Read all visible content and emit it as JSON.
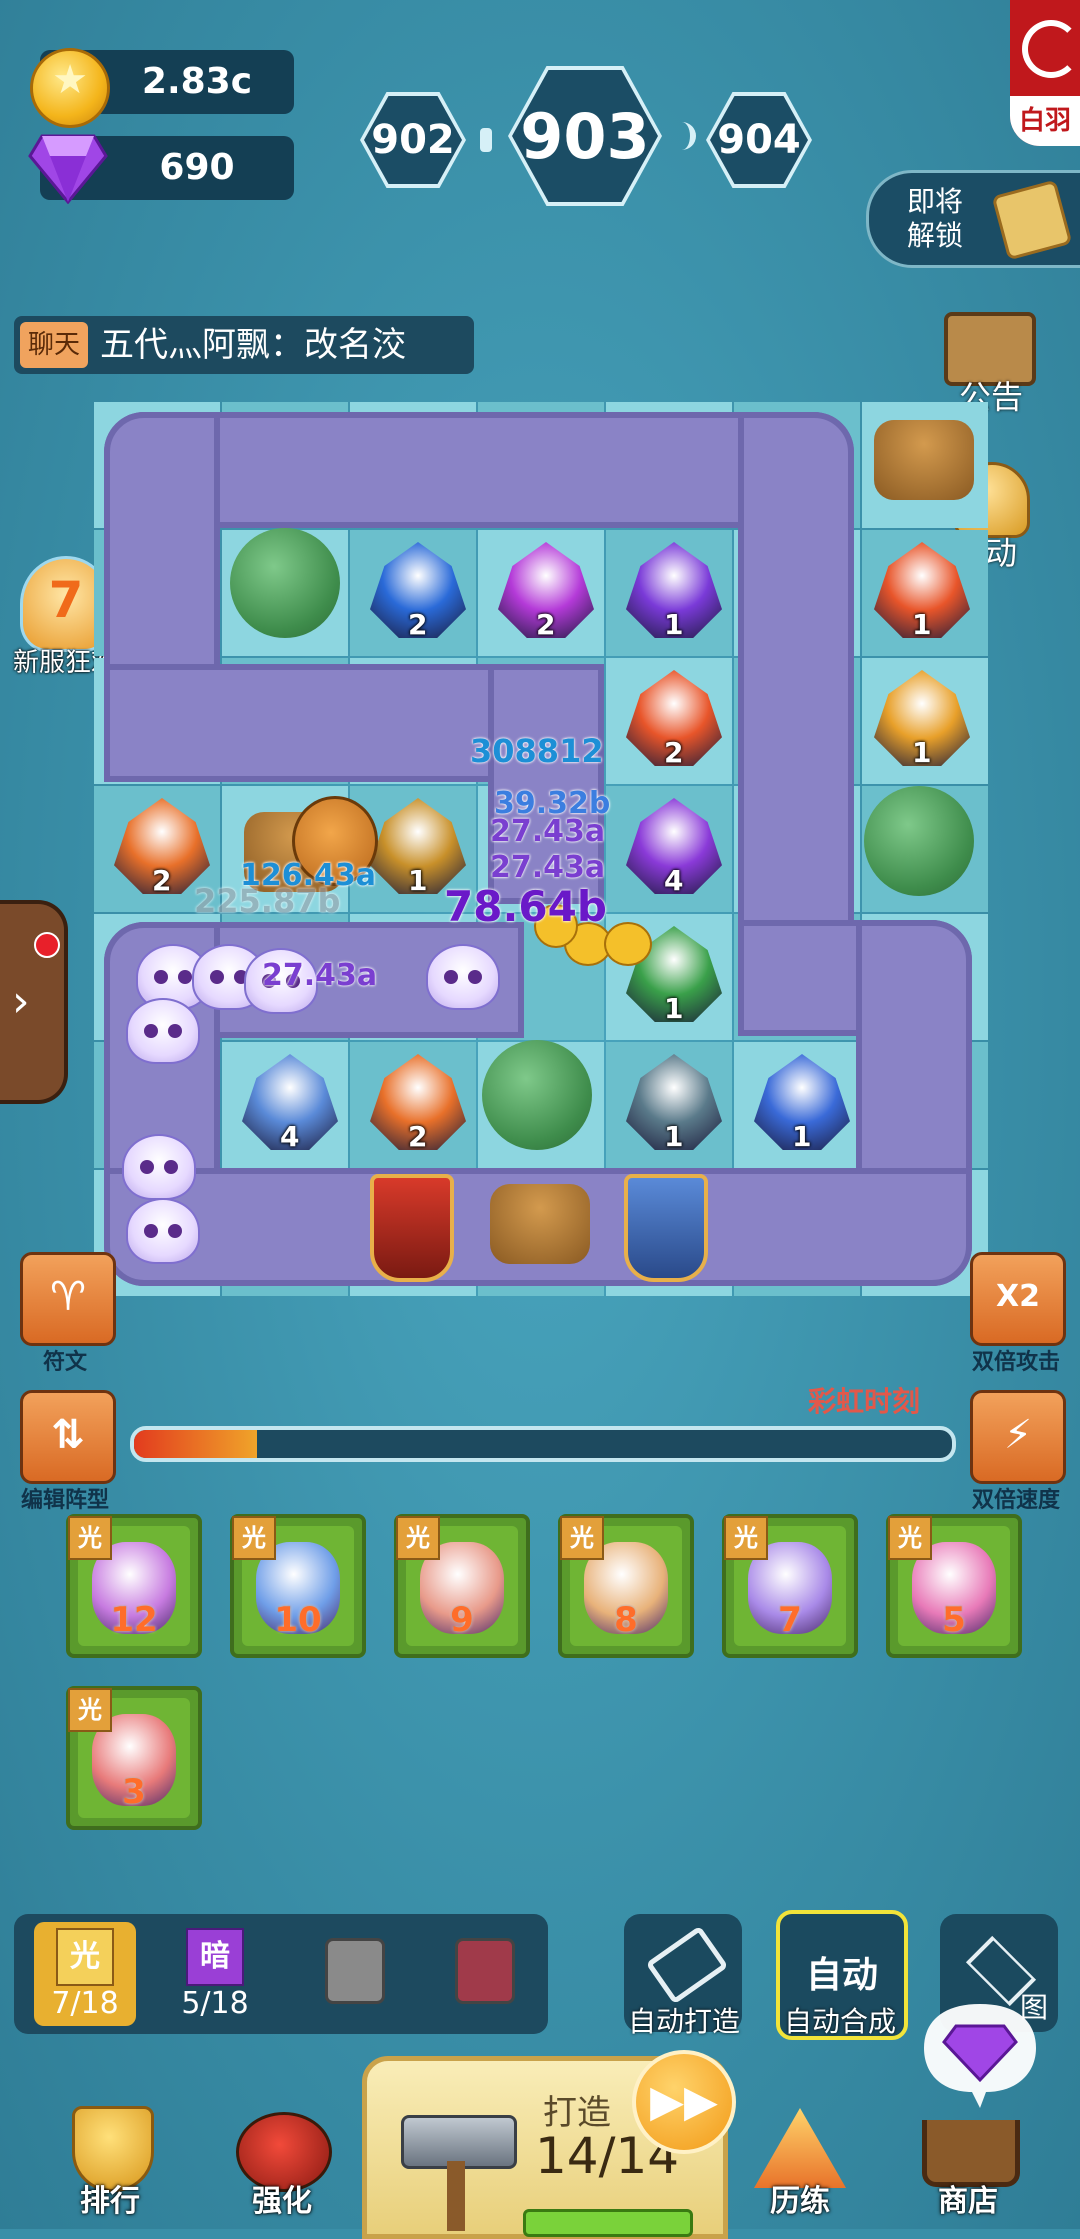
{
  "resources": {
    "gold": "2.83c",
    "gems": "690"
  },
  "levels": {
    "prev": "902",
    "current": "903",
    "next": "904"
  },
  "top_right": {
    "logo_text": "白羽",
    "unlock_label": "即将\n解锁"
  },
  "chat": {
    "tag": "聊天",
    "message": "五代灬阿飘：改名洨"
  },
  "side_right": {
    "notice": "公告",
    "activity": "活动"
  },
  "side_left": {
    "event": "新服狂欢",
    "event_number": "7"
  },
  "board": {
    "pieces": [
      {
        "level": "2"
      },
      {
        "level": "2"
      },
      {
        "level": "1"
      },
      {
        "level": "1"
      },
      {
        "level": "2"
      },
      {
        "level": "1"
      },
      {
        "level": "2"
      },
      {
        "level": "1"
      },
      {
        "level": "4"
      },
      {
        "level": "1"
      },
      {
        "level": "4"
      },
      {
        "level": "2"
      },
      {
        "level": "1"
      },
      {
        "level": "1"
      }
    ],
    "damage": [
      {
        "text": "308812",
        "color": "#1d8fd6"
      },
      {
        "text": "39.32b",
        "color": "#3b7ee0"
      },
      {
        "text": "27.43a",
        "color": "#7a3fd0"
      },
      {
        "text": "27.43a",
        "color": "#7a3fd0"
      },
      {
        "text": "126.43a",
        "color": "#1d8fd6"
      },
      {
        "text": "225.87b",
        "color": "#9aa0a8"
      },
      {
        "text": "78.64b",
        "color": "#6a19c8"
      },
      {
        "text": "27.43a",
        "color": "#7a3fd0"
      }
    ]
  },
  "controls": {
    "rune": "符文",
    "formation": "编辑阵型",
    "double_attack": "双倍攻击",
    "double_attack_badge": "X2",
    "double_speed": "双倍速度",
    "rainbow": "彩虹时刻",
    "progress": 0.15
  },
  "cards": [
    {
      "badge": "光",
      "number": "12",
      "color": "#c77be0"
    },
    {
      "badge": "光",
      "number": "10",
      "color": "#6f9ee8"
    },
    {
      "badge": "光",
      "number": "9",
      "color": "#e89a8a"
    },
    {
      "badge": "光",
      "number": "8",
      "color": "#e8b27a"
    },
    {
      "badge": "光",
      "number": "7",
      "color": "#a98ae8"
    },
    {
      "badge": "光",
      "number": "5",
      "color": "#e87ab8"
    },
    {
      "badge": "光",
      "number": "3",
      "color": "#e87a7a"
    }
  ],
  "elements": [
    {
      "glyph": "光",
      "count": "7/18"
    },
    {
      "glyph": "暗",
      "count": "5/18"
    }
  ],
  "actions": {
    "auto_forge": "自动打造",
    "auto_merge_btn": "自动",
    "auto_merge": "自动合成",
    "layers_partial": "图"
  },
  "forge": {
    "label": "打造",
    "count": "14/14",
    "ff": "▶▶"
  },
  "nav": {
    "rank": "排行",
    "strengthen": "强化",
    "training": "历练",
    "shop": "商店"
  },
  "colors": {
    "accent": "#f29a17",
    "path": "#8a83c6",
    "card_green": "#6fb534"
  }
}
